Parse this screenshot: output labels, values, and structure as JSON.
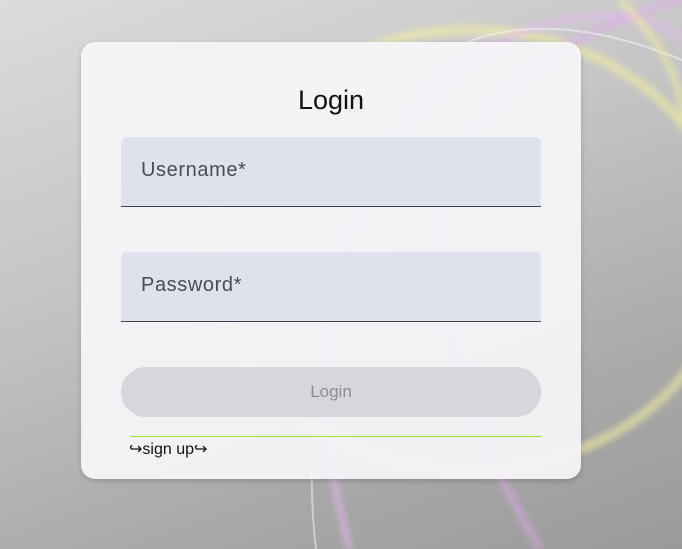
{
  "login_card": {
    "title": "Login",
    "username_label": "Username*",
    "password_label": "Password*",
    "login_button_label": "Login",
    "signup_link_label": "↪sign up↪"
  },
  "colors": {
    "accent_line": "#9ae03f",
    "field_background": "#dde0ec",
    "button_disabled": "#d2d1d6"
  }
}
